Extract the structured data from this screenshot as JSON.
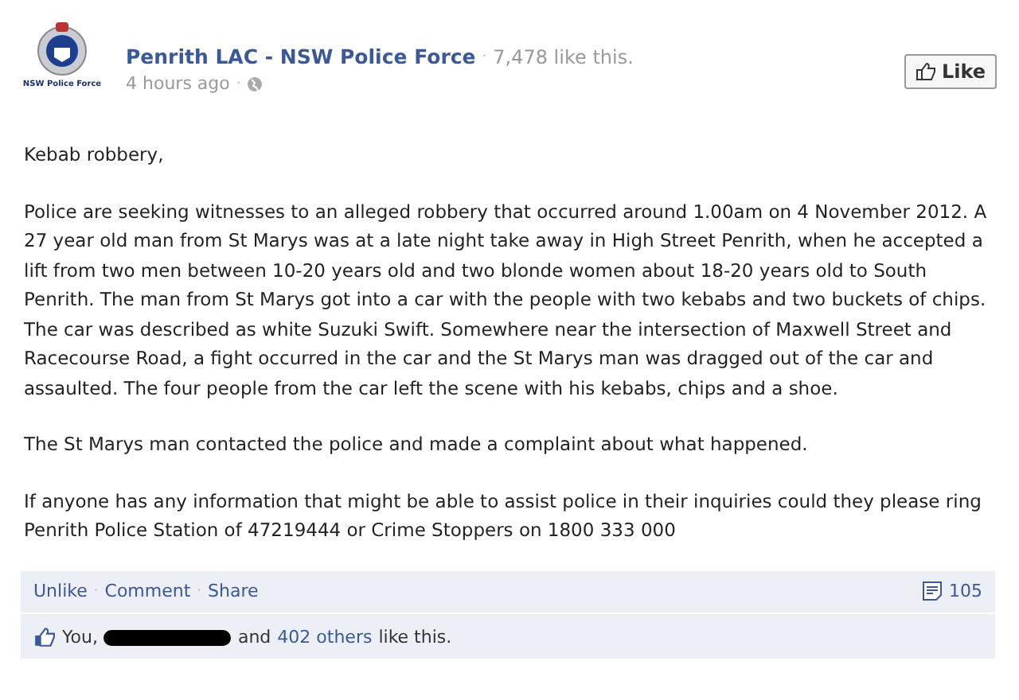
{
  "post": {
    "logo_caption": "NSW Police Force",
    "page_name": "Penrith LAC - NSW Police Force",
    "page_likes": "7,478 like this.",
    "time": "4 hours ago",
    "like_button": "Like",
    "paragraphs": [
      "Kebab robbery,",
      "Police are seeking witnesses to an alleged robbery that occurred around 1.00am on 4 November 2012. A 27 year old man from St Marys was at a late night take away in High Street Penrith, when he accepted a lift from two men between 10-20 years old and two blonde women about 18-20 years old to South Penrith. The man from St Marys got into a car with the people with two kebabs and two buckets of chips. The car was described as white Suzuki Swift. Somewhere near the intersection of Maxwell Street and Racecourse Road, a fight occurred in the car and the St Marys man was dragged out of the car and assaulted. The four people from the car left the scene with his kebabs, chips and a shoe.",
      "The St Marys man contacted the police and made a complaint about what happened.",
      "If anyone has any information that might be able to assist police in their inquiries could they please ring Penrith Police Station of 47219444 or Crime Stoppers on 1800 333 000"
    ]
  },
  "actions": [
    "Unlike",
    "Comment",
    "Share"
  ],
  "separator": "·",
  "comment_count": "105",
  "likes": {
    "prefix": "You,",
    "redacted": true,
    "and": "and",
    "others": "402 others",
    "suffix": "like this."
  }
}
